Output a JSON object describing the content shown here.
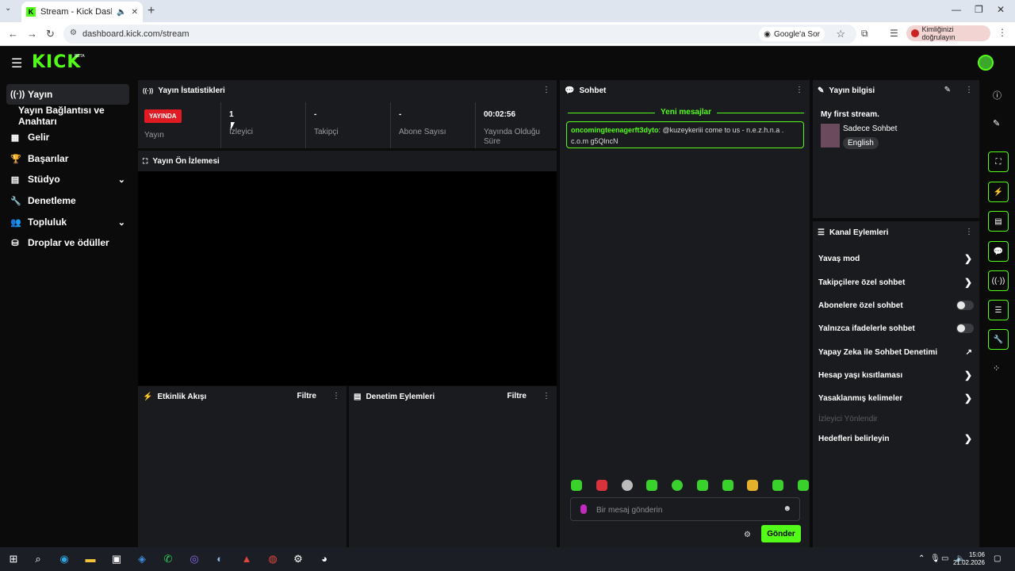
{
  "browser": {
    "tab_title": "Stream - Kick Dashboard",
    "url": "dashboard.kick.com/stream",
    "google_button": "Google'a Sor",
    "verify_label": "Kimliğinizi doğrulayın"
  },
  "header": {
    "logo": "KICK",
    "beta": "BETA"
  },
  "sidebar": {
    "items": [
      {
        "label": "Yayın",
        "icon": "broadcast-icon"
      },
      {
        "label": "Yayın Bağlantısı ve Anahtarı",
        "icon": ""
      },
      {
        "label": "Gelir",
        "icon": "chart-icon"
      },
      {
        "label": "Başarılar",
        "icon": "trophy-icon"
      },
      {
        "label": "Stüdyo",
        "icon": "studio-icon"
      },
      {
        "label": "Denetleme",
        "icon": "wrench-icon"
      },
      {
        "label": "Topluluk",
        "icon": "community-icon"
      },
      {
        "label": "Droplar ve ödüller",
        "icon": "drops-icon"
      }
    ]
  },
  "stats_panel": {
    "title": "Yayın İstatistikleri",
    "live_badge": "YAYINDA",
    "stream_label": "Yayın",
    "stats": [
      {
        "value": "1",
        "label": "İzleyici"
      },
      {
        "value": "-",
        "label": "Takipçi"
      },
      {
        "value": "-",
        "label": "Abone Sayısı"
      },
      {
        "value": "00:02:56",
        "label": "Yayında Olduğu Süre"
      }
    ]
  },
  "preview_panel": {
    "title": "Yayın Ön İzlemesi"
  },
  "activity_panel": {
    "title": "Etkinlik Akışı",
    "filter": "Filtre"
  },
  "moderation_panel": {
    "title": "Denetim Eylemleri",
    "filter": "Filtre"
  },
  "chat": {
    "title": "Sohbet",
    "new_messages": "Yeni mesajlar",
    "message_user": "oncomingteenagerft3dyto",
    "message_text": ": @kuzeykeriii come to us - n.e.z.h.n.a . c.o.m g5QlncN",
    "input_placeholder": "Bir mesaj gönderin",
    "send_label": "Gönder"
  },
  "stream_info": {
    "title": "Yayın bilgisi",
    "stream_title": "My first stream.",
    "category": "Sadece Sohbet",
    "language": "English"
  },
  "channel_actions": {
    "title": "Kanal Eylemleri",
    "items": [
      {
        "label": "Yavaş mod",
        "control": "arrow"
      },
      {
        "label": "Takipçilere özel sohbet",
        "control": "arrow"
      },
      {
        "label": "Abonelere özel sohbet",
        "control": "toggle",
        "on": false
      },
      {
        "label": "Yalnızca ifadelerle sohbet",
        "control": "toggle",
        "on": false
      },
      {
        "label": "Yapay Zeka ile Sohbet Denetimi",
        "control": "external"
      },
      {
        "label": "Hesap yaşı kısıtlaması",
        "control": "arrow"
      },
      {
        "label": "Yasaklanmış kelimeler",
        "control": "arrow"
      },
      {
        "label": "İzleyici Yönlendir",
        "control": "none",
        "disabled": true
      },
      {
        "label": "Hedefleri belirleyin",
        "control": "arrow"
      }
    ]
  },
  "taskbar": {
    "time": "15:06",
    "date": "21.02.2026"
  },
  "colors": {
    "accent": "#53fc18",
    "live": "#e01b24",
    "panel": "#1a1b1e"
  }
}
